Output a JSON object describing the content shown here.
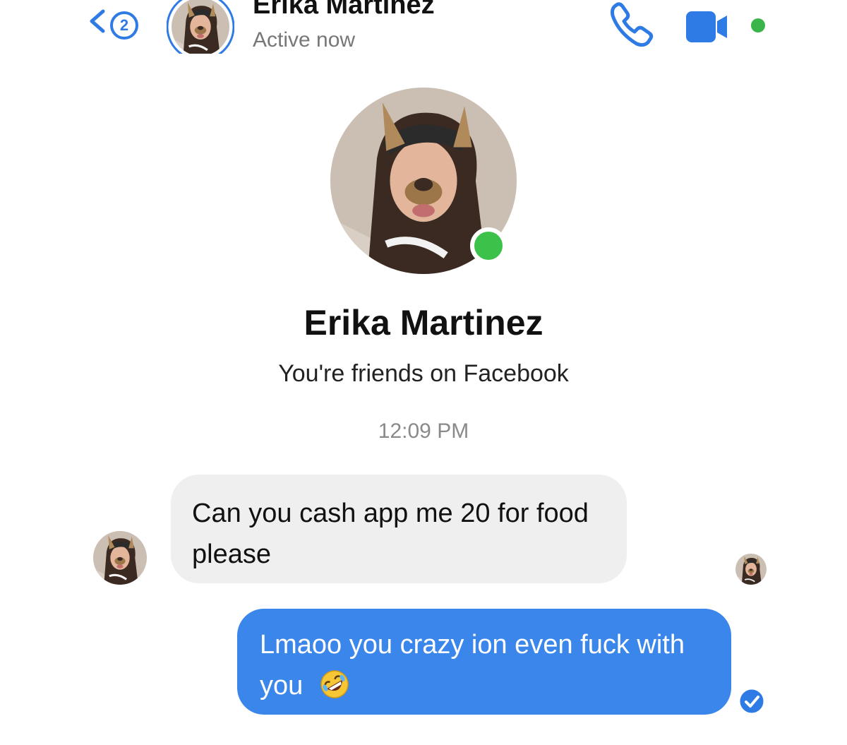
{
  "header": {
    "back_badge_count": "2",
    "contact_name": "Erika Martinez",
    "status": "Active now",
    "icons": {
      "back": "chevron-left-icon",
      "call": "phone-icon",
      "video": "video-camera-icon",
      "video_status": "green-dot"
    }
  },
  "profile": {
    "name": "Erika Martinez",
    "relation": "You're friends on Facebook",
    "online": true
  },
  "conversation": {
    "timestamp": "12:09 PM",
    "messages": [
      {
        "direction": "incoming",
        "text": "Can you cash app me 20 for food please"
      },
      {
        "direction": "outgoing",
        "text": "Lmaoo you crazy ion even fuck with you",
        "emoji": "rolling-on-floor-laughing-emoji",
        "status": "delivered"
      }
    ]
  },
  "colors": {
    "accent": "#2f7be5",
    "outgoing_bubble": "#3b86ea",
    "incoming_bubble": "#efefef",
    "online": "#3cc24a"
  }
}
